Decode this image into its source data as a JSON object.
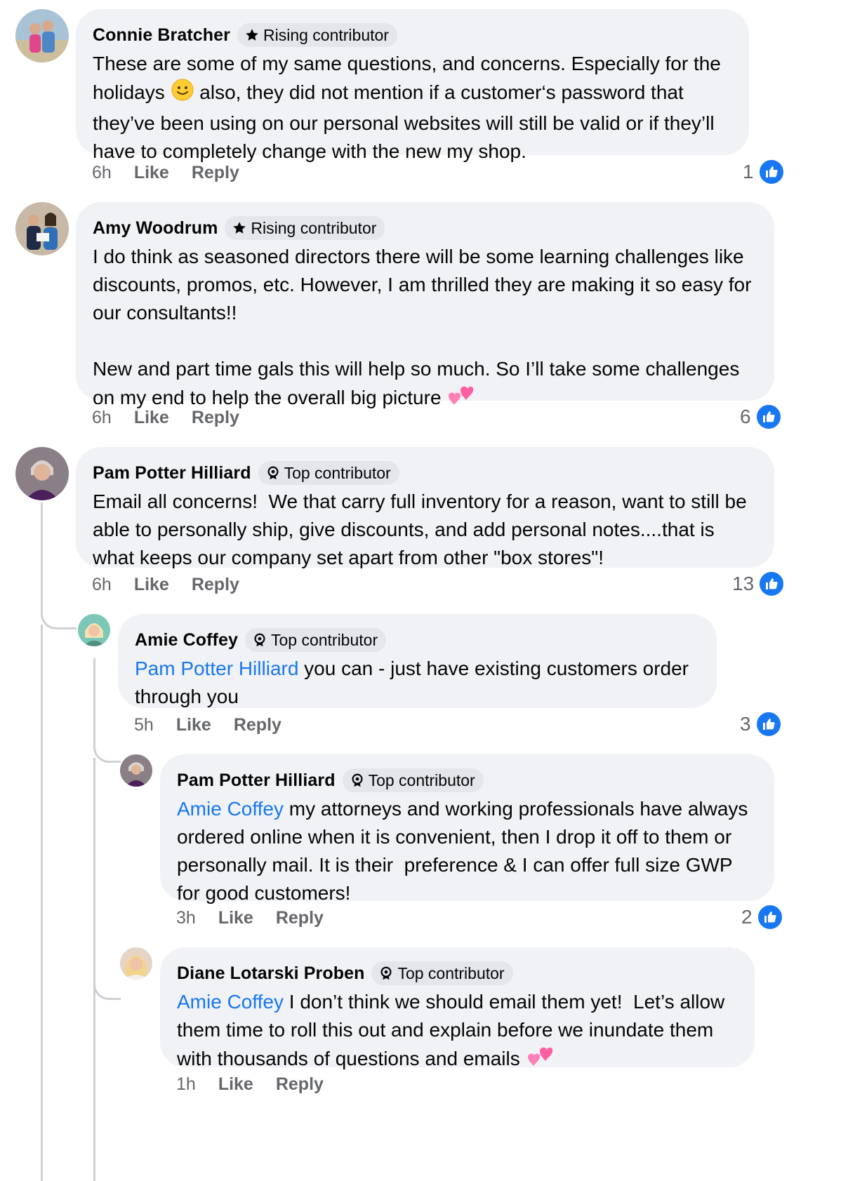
{
  "comments": [
    {
      "name": "Connie Bratcher",
      "badge": "Rising contributor",
      "text_before": "These are some of my same questions, and concerns. Especially for the holidays ",
      "emoji": "slight-smile",
      "text_after": " also, they did not mention if a customer‘s password that they’ve been using on our personal websites will still be valid or if they’ll have to completely change with the new my shop.",
      "time": "6h",
      "like": "Like",
      "reply": "Reply",
      "likes": "1"
    },
    {
      "name": "Amy Woodrum",
      "badge": "Rising contributor",
      "text": "I do think as seasoned directors there will be some learning challenges like discounts, promos, etc. However, I am thrilled they are making it so easy for our consultants!!\n\nNew and part time gals this will help so much. So I’ll take some challenges on my end to help the overall big picture ",
      "emoji": "two-hearts",
      "time": "6h",
      "like": "Like",
      "reply": "Reply",
      "likes": "6"
    },
    {
      "name": "Pam Potter Hilliard",
      "badge": "Top contributor",
      "text": "Email all concerns!  We that carry full inventory for a reason, want to still be able to personally ship, give discounts, and add personal notes....that is what keeps our company set apart from other \"box stores\"!",
      "time": "6h",
      "like": "Like",
      "reply": "Reply",
      "likes": "13"
    },
    {
      "name": "Amie Coffey",
      "badge": "Top contributor",
      "mention": "Pam Potter Hilliard",
      "text": " you can - just have existing customers order through you",
      "time": "5h",
      "like": "Like",
      "reply": "Reply",
      "likes": "3"
    },
    {
      "name": "Pam Potter Hilliard",
      "badge": "Top contributor",
      "mention": "Amie Coffey",
      "text": " my attorneys and working professionals have always ordered online when it is convenient, then I drop it off to them or personally mail. It is their  preference & I can offer full size GWP for good customers!",
      "time": "3h",
      "like": "Like",
      "reply": "Reply",
      "likes": "2"
    },
    {
      "name": "Diane Lotarski Proben",
      "badge": "Top contributor",
      "mention": "Amie Coffey",
      "text": " I don’t think we should email them yet!  Let’s allow them time to roll this out and explain before we inundate them with thousands of questions and emails ",
      "emoji": "two-hearts",
      "time": "1h",
      "like": "Like",
      "reply": "Reply"
    }
  ],
  "colors": {
    "bubble": "#f0f2f5",
    "badge": "#e4e6eb",
    "mention": "#1877f2",
    "meta": "#65676b",
    "like_blue": "#1877f2"
  }
}
